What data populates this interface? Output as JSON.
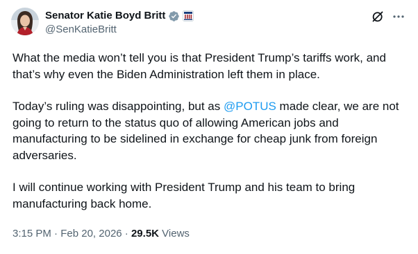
{
  "author": {
    "display_name": "Senator Katie Boyd Britt",
    "handle": "@SenKatieBritt"
  },
  "tweet": {
    "paragraph1": "What the media won’t tell you is that President Trump’s tariffs work, and that’s why even the Biden Administration left them in place.",
    "paragraph2_before": "Today’s ruling was disappointing, but as ",
    "paragraph2_mention": "@POTUS",
    "paragraph2_after": " made clear, we are not going to return to the status quo of allowing American jobs and manufacturing to be sidelined in exchange for cheap junk from foreign adversaries.",
    "paragraph3": "I will continue working with President Trump and his team to bring manufacturing back home."
  },
  "meta": {
    "time": "3:15 PM",
    "separator1": " · ",
    "date": "Feb 20, 2026",
    "separator2": " · ",
    "views_count": "29.5K",
    "views_label": " Views"
  },
  "icons": {
    "verified": "verified-badge-icon",
    "affiliate": "us-senate-affiliation-icon",
    "grok": "grok-icon",
    "more": "more-dots-icon"
  },
  "colors": {
    "text": "#0f1419",
    "secondary": "#536471",
    "link": "#1d9bf0",
    "verified_gray": "#829aab"
  }
}
